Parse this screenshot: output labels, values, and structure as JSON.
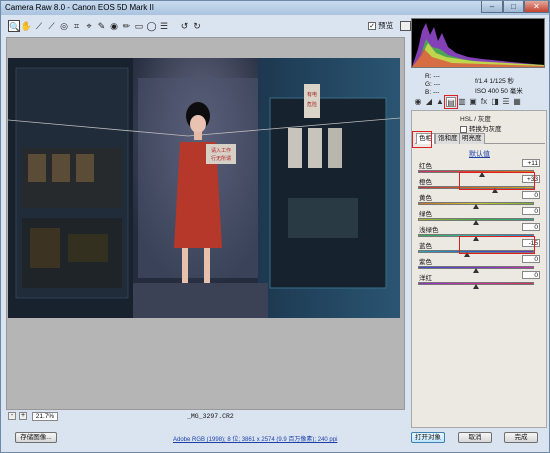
{
  "window": {
    "title": "Camera Raw 8.0 -  Canon EOS 5D Mark II",
    "minimize": "–",
    "maximize": "□",
    "close": "✕"
  },
  "toolbar": {
    "tools": [
      "zoom-tool",
      "hand-tool",
      "white-balance-tool",
      "color-sampler-tool",
      "targeted-adjustment-tool",
      "crop-tool",
      "straighten-tool",
      "spot-removal-tool",
      "red-eye-removal-tool",
      "adjustment-brush",
      "graduated-filter",
      "radial-filter",
      "preferences",
      "rotate-ccw",
      "rotate-cw"
    ],
    "tool_glyphs": [
      "🔍",
      "✋",
      "⟋",
      "⟋",
      "◎",
      "⌗",
      "⌖",
      "✎",
      "◉",
      "✏",
      "▭",
      "◯",
      "☰",
      "↺",
      "↻"
    ],
    "preview_label": "预览",
    "preview_checked": "✓"
  },
  "info": {
    "r": "R:  ---",
    "g": "G:  ---",
    "b": "B:  ---",
    "aperture": "f/1.4   1/125 秒",
    "iso": "ISO 400   50 毫米"
  },
  "panel_tabs": [
    "basic",
    "tone-curve",
    "detail",
    "hsl-grayscale",
    "split-toning",
    "lens-corrections",
    "effects",
    "camera-calibration",
    "presets",
    "snapshots"
  ],
  "panel_tab_glyphs": [
    "◉",
    "◢",
    "▲",
    "▤",
    "▥",
    "▣",
    "fx",
    "◨",
    "☰",
    "▦"
  ],
  "hsl": {
    "title": "HSL / 灰度",
    "grayscale_label": "转换为灰度",
    "subtabs": [
      "色相",
      "饱和度",
      "明亮度"
    ],
    "default_link": "默认值",
    "sliders": [
      {
        "label": "红色",
        "value": "+11",
        "pos": 0.555,
        "gradient": "linear-gradient(90deg,#d12b6c,#d24a2a,#d57a1e)"
      },
      {
        "label": "橙色",
        "value": "+33",
        "pos": 0.665,
        "gradient": "linear-gradient(90deg,#c4313a,#d07020,#c9a82a)"
      },
      {
        "label": "黄色",
        "value": "0",
        "pos": 0.5,
        "gradient": "linear-gradient(90deg,#c8702a,#cfc733,#78b23a)"
      },
      {
        "label": "绿色",
        "value": "0",
        "pos": 0.5,
        "gradient": "linear-gradient(90deg,#a9b832,#3fae45,#2ba58f)"
      },
      {
        "label": "浅绿色",
        "value": "0",
        "pos": 0.5,
        "gradient": "linear-gradient(90deg,#3cab55,#2fb3ae,#2b7fc7)"
      },
      {
        "label": "蓝色",
        "value": "-15",
        "pos": 0.425,
        "gradient": "linear-gradient(90deg,#2fa7b3,#2c5fcc,#6a38c2)"
      },
      {
        "label": "紫色",
        "value": "0",
        "pos": 0.5,
        "gradient": "linear-gradient(90deg,#3a4bd0,#7c36c4,#c233a8)"
      },
      {
        "label": "洋红",
        "value": "0",
        "pos": 0.5,
        "gradient": "linear-gradient(90deg,#8b33c6,#c9339a,#d22f5a)"
      }
    ]
  },
  "zoom": {
    "minus": "-",
    "plus": "+",
    "level": "21.7%"
  },
  "filename": "_MG_3297.CR2",
  "bottom": {
    "save_label": "存储图像...",
    "workflow": "Adobe RGB (1998); 8 位; 3861 x 2574 (9.9 百万像素); 240 ppi",
    "open_label": "打开对象",
    "cancel_label": "取消",
    "done_label": "完成"
  },
  "photo_text": {
    "sign_1": "请入工作",
    "sign_2": "行无所谓",
    "panel_sign_1": "有电",
    "panel_sign_2": "危险"
  }
}
